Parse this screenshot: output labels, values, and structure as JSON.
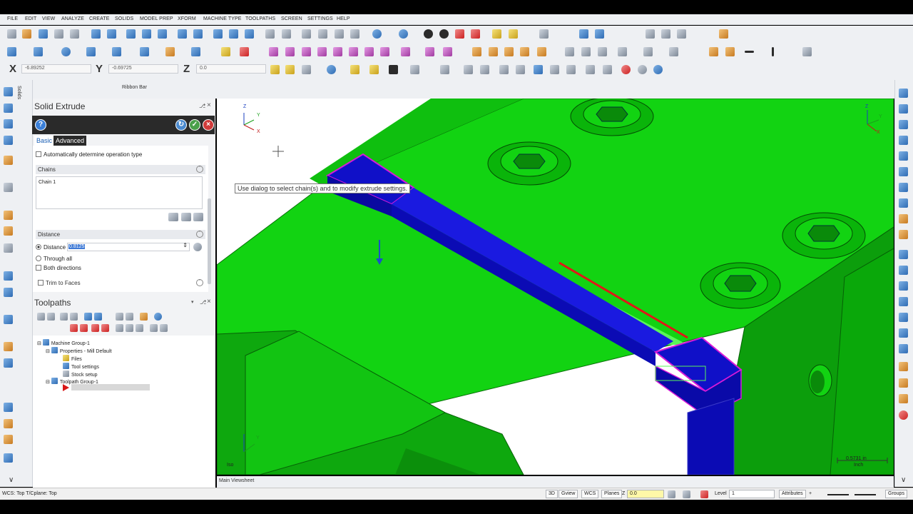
{
  "menu": [
    "FILE",
    "EDIT",
    "VIEW",
    "ANALYZE",
    "CREATE",
    "SOLIDS",
    "MODEL PREP",
    "XFORM",
    "MACHINE TYPE",
    "TOOLPATHS",
    "SCREEN",
    "SETTINGS",
    "HELP"
  ],
  "coords": {
    "x_label": "X",
    "x_value": "-6.89252",
    "y_label": "Y",
    "y_value": "-0.69725",
    "z_label": "Z",
    "z_value": "0.0"
  },
  "ribbon_bar_label": "Ribbon Bar",
  "solids_tab_label": "Solids",
  "solid_extrude": {
    "title": "Solid Extrude",
    "help_icon": "?",
    "tabs": [
      "Basic",
      "Advanced"
    ],
    "auto_op_label": "Automatically determine operation type",
    "chains_header": "Chains",
    "chain_items": [
      "Chain  1"
    ],
    "distance_header": "Distance",
    "distance_label": "Distance",
    "distance_value": "0.8125",
    "through_all_label": "Through all",
    "both_directions_label": "Both directions",
    "trim_to_faces_label": "Trim to Faces"
  },
  "toolpaths": {
    "title": "Toolpaths",
    "tree": [
      {
        "label": "Machine Group-1",
        "level": 0
      },
      {
        "label": "Properties - Mill Default",
        "level": 1
      },
      {
        "label": "Files",
        "level": 2
      },
      {
        "label": "Tool settings",
        "level": 2
      },
      {
        "label": "Stock setup",
        "level": 2
      },
      {
        "label": "Toolpath Group-1",
        "level": 1
      }
    ]
  },
  "viewport": {
    "tooltip": "Use dialog to select chain(s) and to modify extrude settings.",
    "view_label": "Iso",
    "scale_value": "0.5731 in",
    "scale_unit": "Inch",
    "axis_x": "X",
    "axis_y": "Y",
    "axis_z": "Z"
  },
  "bottom_tab": "Main Viewsheet",
  "status": {
    "wcs_text": "WCS: Top  T/Cplane: Top",
    "btn_3d": "3D",
    "gview": "Gview",
    "wcs": "WCS",
    "planes": "Planes",
    "z_label": "Z",
    "z_value": "0.0",
    "level_label": "Level",
    "level_value": "1",
    "attributes": "Attributes",
    "groups": "Groups"
  },
  "colors": {
    "ui_bg": "#eef0f3",
    "model_green": "#12d312",
    "model_dark_green": "#0a9a0a",
    "selected_blue": "#1010c8",
    "edge_magenta": "#d81ad8",
    "accent_red": "#e01818"
  }
}
